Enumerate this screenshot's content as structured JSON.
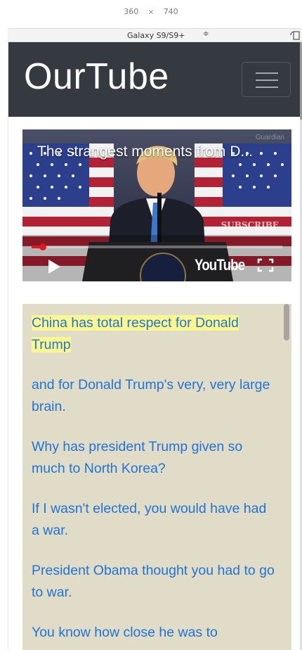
{
  "devtools": {
    "width": "360",
    "times": "×",
    "height": "740",
    "device": "Galaxy S9/S9+",
    "selector_arrows": "≑"
  },
  "navbar": {
    "brand": "OurTube",
    "menu_icon": "hamburger-icon"
  },
  "video": {
    "title": "The strangest moments from D...",
    "watermark": "Guardian",
    "subscribe": "SUBSCRIBE",
    "logo": "YouTube",
    "progress_fraction": 0.045
  },
  "transcript": {
    "lines": [
      "China has total respect for Donald Trump",
      "and for Donald Trump's very, very large brain.",
      "Why has president Trump given so much to North Korea?",
      "If I wasn't elected, you would have had a war.",
      "President Obama thought you had to go to war.",
      "You know how close he was to"
    ],
    "active_index": 0,
    "colors": {
      "background": "#e1dcc8",
      "text": "#1f74d6",
      "highlight": "#fbf68e"
    }
  }
}
